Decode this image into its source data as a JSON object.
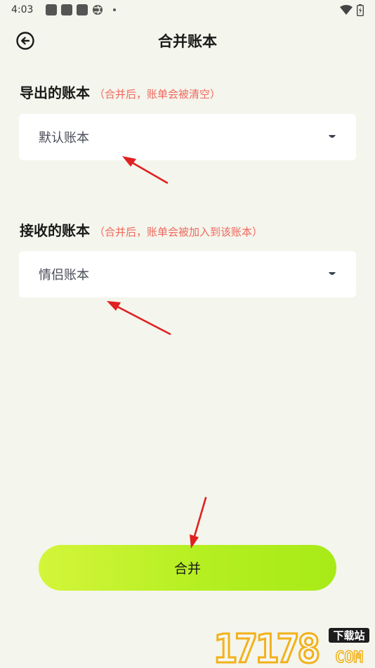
{
  "status_bar": {
    "time": "4:03"
  },
  "header": {
    "title": "合并账本",
    "back_icon": "back-circle-arrow-icon"
  },
  "export_section": {
    "title": "导出的账本",
    "hint": "（合并后，账单会被清空）",
    "selected_value": "默认账本"
  },
  "receive_section": {
    "title": "接收的账本",
    "hint": "（合并后，账单会被加入到该账本）",
    "selected_value": "情侣账本"
  },
  "merge_button": {
    "label": "合并"
  },
  "watermark": {
    "number": "17178",
    "tag": "下载站",
    "domain": "COM"
  },
  "colors": {
    "background": "#f4f5ec",
    "hint": "#f0685e",
    "button_gradient_start": "#d4f53a",
    "button_gradient_end": "#a8ea18",
    "annotation_arrow": "#e02020"
  }
}
